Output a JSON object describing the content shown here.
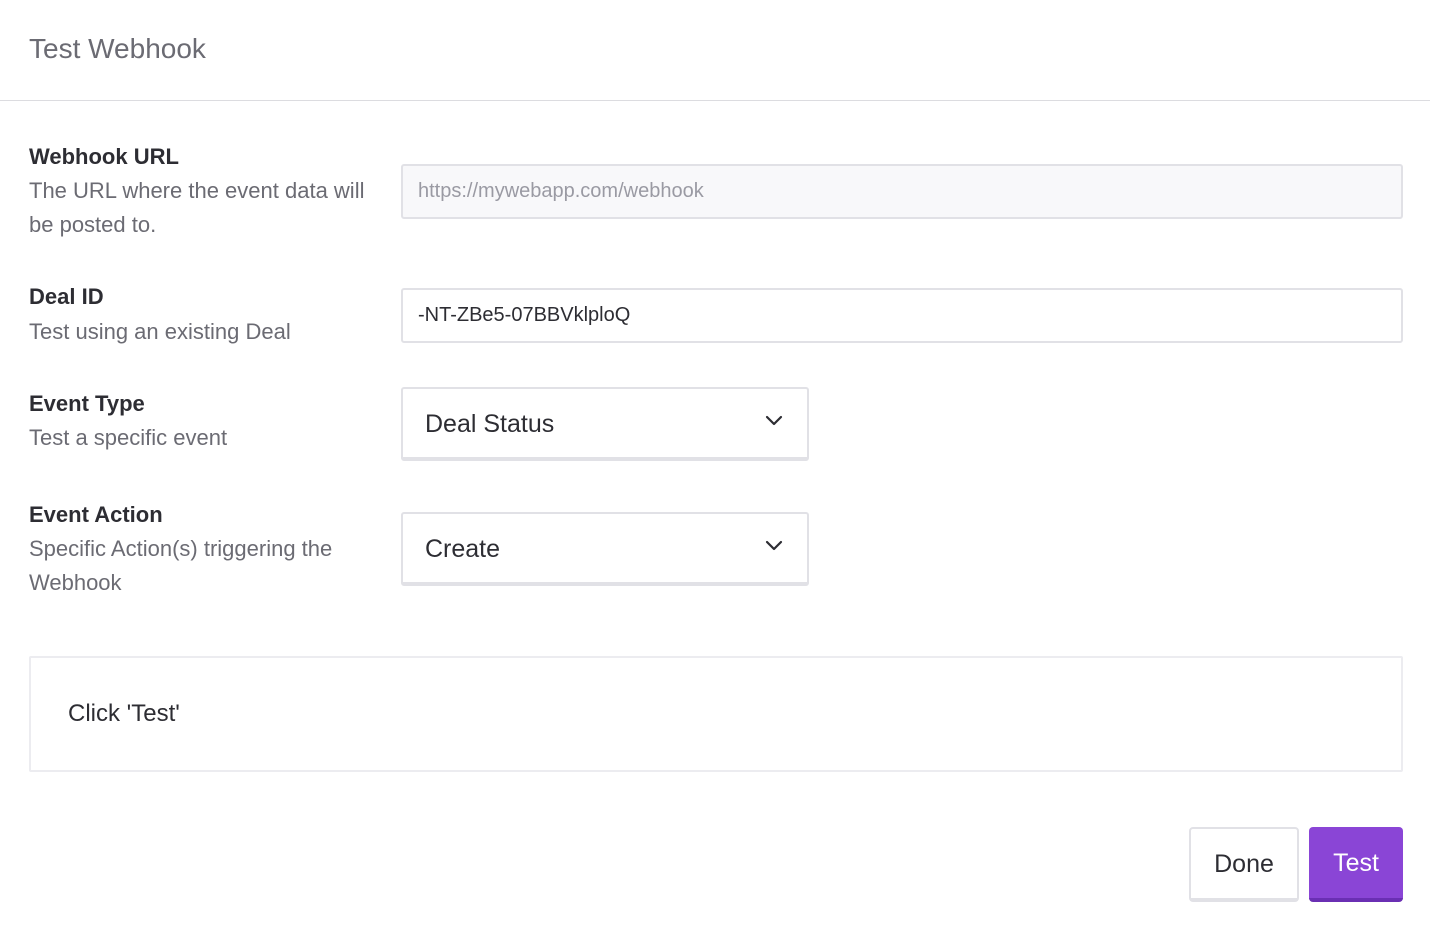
{
  "modal": {
    "title": "Test Webhook"
  },
  "fields": {
    "webhook_url": {
      "label": "Webhook URL",
      "description": "The URL where the event data will be posted to.",
      "value": "https://mywebapp.com/webhook"
    },
    "deal_id": {
      "label": "Deal ID",
      "description": "Test using an existing Deal",
      "value": "-NT-ZBe5-07BBVklploQ"
    },
    "event_type": {
      "label": "Event Type",
      "description": "Test a specific event",
      "selected": "Deal Status"
    },
    "event_action": {
      "label": "Event Action",
      "description": "Specific Action(s) triggering the Webhook",
      "selected": "Create"
    }
  },
  "result": {
    "text": "Click 'Test'"
  },
  "footer": {
    "done_label": "Done",
    "test_label": "Test"
  },
  "colors": {
    "accent": "#8a45d6",
    "border": "#e1e1e6"
  },
  "icons": {
    "select_chevron": "chevron-down-icon"
  }
}
